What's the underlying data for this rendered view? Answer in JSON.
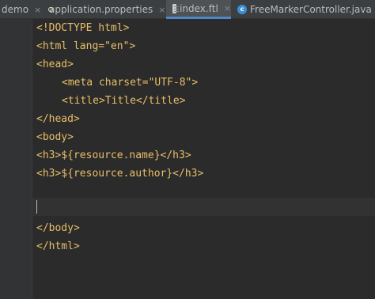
{
  "tabs": [
    {
      "label": "demo",
      "icon": "none",
      "active": false
    },
    {
      "label": "application.properties",
      "icon": "spring-leaf-icon",
      "active": false
    },
    {
      "label": "index.ftl",
      "icon": "file-icon",
      "active": true
    },
    {
      "label": "FreeMarkerController.java",
      "icon": "class-icon",
      "active": false
    }
  ],
  "close_glyph": "×",
  "class_icon_letter": "c",
  "editor": {
    "lines": [
      "<!DOCTYPE html>",
      "<html lang=\"en\">",
      "<head>",
      "<meta charset=\"UTF-8\">",
      "<title>Title</title>",
      "</head>",
      "<body>",
      "<h3>${resource.name}</h3>",
      "<h3>${resource.author}</h3>",
      "",
      "",
      "</body>",
      "</html>"
    ]
  },
  "colors": {
    "background": "#2b2b2b",
    "gutter": "#313335",
    "tabbar": "#3c3f41",
    "active_tab": "#4e5254",
    "tag_text": "#e8bf6a",
    "current_line": "#323232"
  }
}
